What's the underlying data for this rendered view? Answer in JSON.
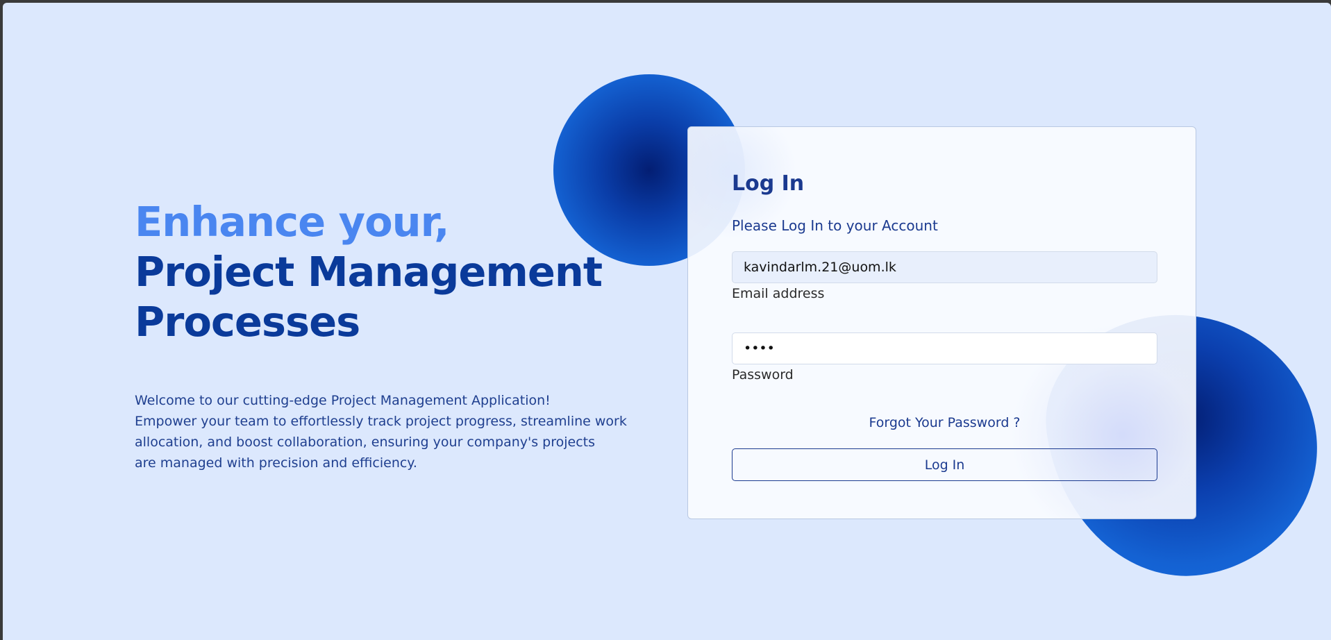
{
  "hero": {
    "line1": "Enhance your,",
    "line2": "Project Management",
    "line3": "Processes",
    "description": [
      "Welcome to our cutting-edge Project Management Application!",
      "Empower your team to effortlessly track project progress, streamline work",
      "allocation, and boost collaboration, ensuring your company's projects",
      "are managed with precision and efficiency."
    ]
  },
  "login": {
    "title": "Log In",
    "subtitle": "Please Log In to your Account",
    "email": {
      "value": "kavindarlm.21@uom.lk",
      "label": "Email address"
    },
    "password": {
      "value": "••••",
      "label": "Password"
    },
    "forgot_link": "Forgot Your Password ?",
    "submit_label": "Log In"
  },
  "colors": {
    "background": "#dce8fd",
    "hero_accent": "#4a86f0",
    "hero_primary": "#0a3a9a",
    "card_text": "#1b3a8f",
    "blob_dark": "#031e73",
    "blob_light": "#1b6fe0"
  }
}
